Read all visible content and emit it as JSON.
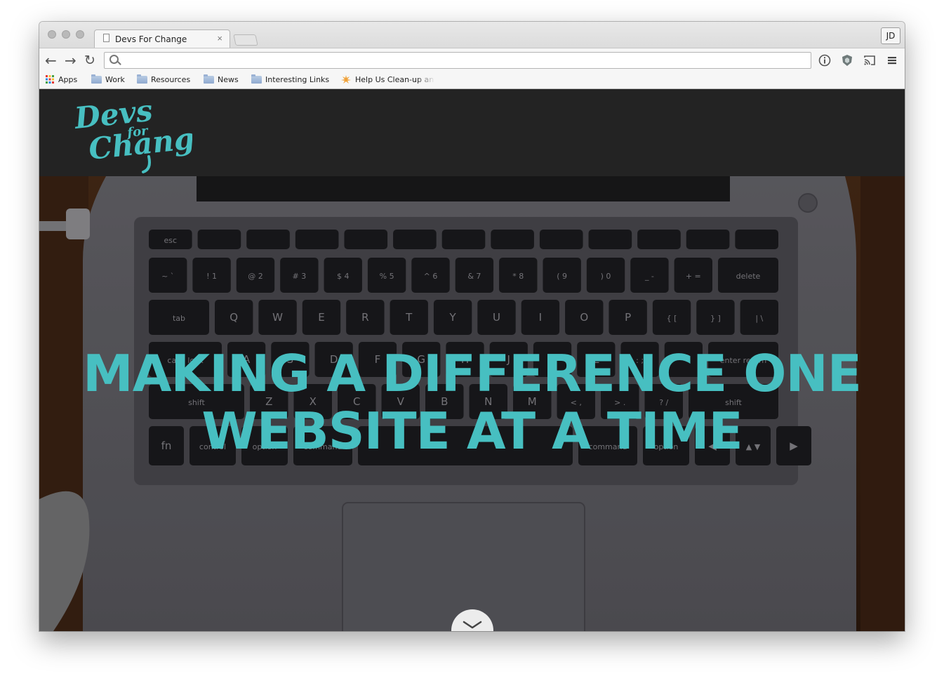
{
  "browser": {
    "tab_title": "Devs For Change",
    "tab_close": "×",
    "profile_initials": "JD",
    "omnibox_value": "",
    "nav": {
      "back": "←",
      "forward": "→",
      "reload": "↻"
    }
  },
  "bookmarks": [
    {
      "label": "Apps",
      "icon": "apps-grid-icon"
    },
    {
      "label": "Work",
      "icon": "folder-icon"
    },
    {
      "label": "Resources",
      "icon": "folder-icon"
    },
    {
      "label": "News",
      "icon": "folder-icon"
    },
    {
      "label": "Interesting Links",
      "icon": "folder-icon"
    },
    {
      "label": "Help Us Clean-up an",
      "icon": "bookmark-favicon"
    }
  ],
  "site": {
    "logo": {
      "line1": "Devs",
      "line2": "for",
      "line3": "Change"
    },
    "hero_line1": "MAKING A DIFFERENCE ONE",
    "hero_line2": "WEBSITE AT A TIME",
    "accent_color": "#47bfc1",
    "header_bg": "#232323"
  },
  "keyboard": {
    "row_fn": [
      "esc",
      "",
      "",
      "",
      "",
      "",
      "",
      "",
      "",
      "",
      "",
      "",
      ""
    ],
    "row_num": [
      "~ `",
      "! 1",
      "@ 2",
      "# 3",
      "$ 4",
      "% 5",
      "^ 6",
      "& 7",
      "* 8",
      "( 9",
      ") 0",
      "_ -",
      "+ =",
      "delete"
    ],
    "row_q": [
      "tab",
      "Q",
      "W",
      "E",
      "R",
      "T",
      "Y",
      "U",
      "I",
      "O",
      "P",
      "{ [",
      "} ]",
      "| \\"
    ],
    "row_a": [
      "caps lock",
      "A",
      "S",
      "D",
      "F",
      "G",
      "H",
      "J",
      "K",
      "L",
      ": ;",
      "\" '",
      "enter return"
    ],
    "row_z": [
      "shift",
      "Z",
      "X",
      "C",
      "V",
      "B",
      "N",
      "M",
      "< ,",
      "> .",
      "? /",
      "shift"
    ],
    "row_bottom": [
      "fn",
      "control",
      "option",
      "command",
      "",
      "command",
      "option",
      "◀",
      "▲ ▼",
      "▶"
    ]
  }
}
